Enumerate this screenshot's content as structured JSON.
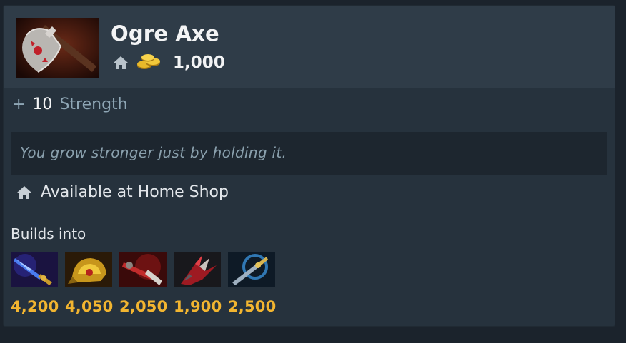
{
  "item": {
    "name": "Ogre Axe",
    "icon": "ogre-axe-icon",
    "cost": "1,000"
  },
  "attribute": {
    "plus": "+",
    "value": "10",
    "name": "Strength"
  },
  "lore": "You grow stronger just by holding it.",
  "shop": {
    "icon": "home-shop-icon",
    "label": "Available at Home Shop"
  },
  "builds_into": {
    "label": "Builds into",
    "items": [
      {
        "icon": "blue-staff-icon",
        "cost": "4,200"
      },
      {
        "icon": "golden-helm-icon",
        "cost": "4,050"
      },
      {
        "icon": "red-blade-icon",
        "cost": "2,050"
      },
      {
        "icon": "red-claw-icon",
        "cost": "1,900"
      },
      {
        "icon": "blue-dagger-icon",
        "cost": "2,500"
      }
    ]
  },
  "colors": {
    "background": "#1b232c",
    "card": "#26323d",
    "header": "#2f3c48",
    "gold": "#f2b530",
    "text": "#f3f4f5",
    "muted": "#8ea6b5"
  }
}
